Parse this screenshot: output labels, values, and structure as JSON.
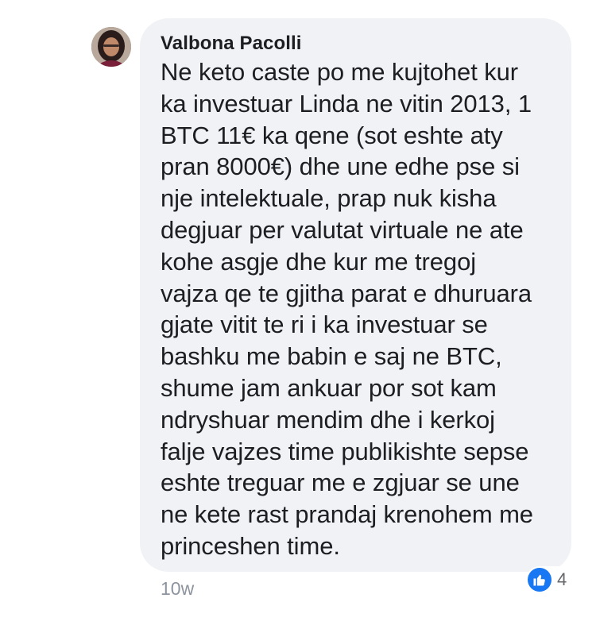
{
  "comment": {
    "author": "Valbona Pacolli",
    "text": "Ne keto caste po me kujtohet kur\nka investuar Linda ne vitin 2013, 1\nBTC 11€ ka qene (sot eshte aty\npran 8000€) dhe une edhe pse si\nnje intelektuale, prap nuk kisha\ndegjuar per valutat virtuale ne ate\nkohe asgje dhe kur me tregoj\nvajza qe te gjitha parat e dhuruara\ngjate vitit te ri i ka investuar se\nbashku me babin e saj ne BTC,\nshume jam ankuar por sot kam\nndryshuar mendim dhe i kerkoj\nfalje vajzes time publikishte sepse\neshte treguar me e zgjuar se une\nne kete rast prandaj krenohem me\nprinceshen time.",
    "timestamp": "10w",
    "reaction_count": "4",
    "reaction_icon": "like-icon"
  },
  "colors": {
    "bubble": "#f0f2f5",
    "like_blue": "#1877f2",
    "meta_gray": "#8d949e"
  }
}
